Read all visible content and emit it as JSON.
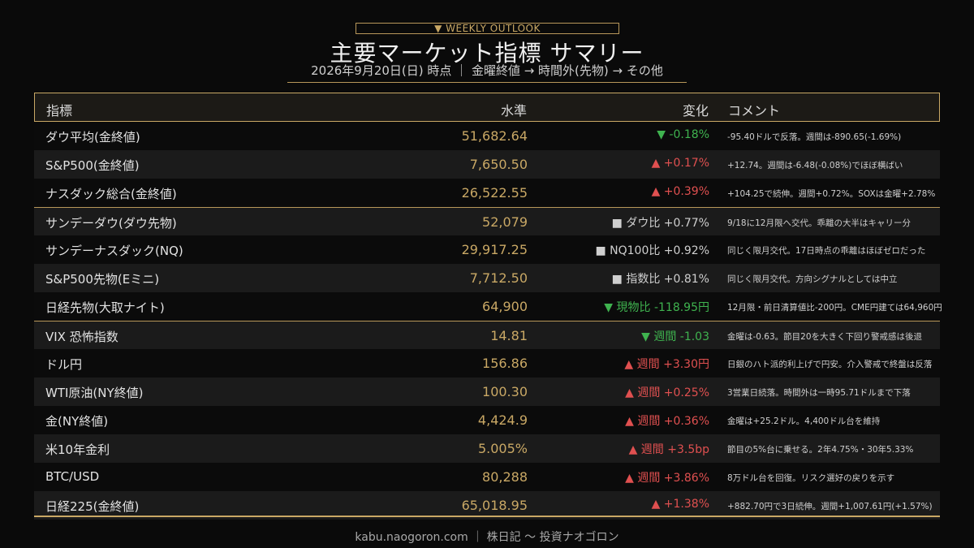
{
  "header": {
    "badge": "▼ WEEKLY OUTLOOK",
    "title": "主要マーケット指標 サマリー",
    "subtitle": "2026年9月20日(日) 時点 ｜ 金曜終値 → 時間外(先物) → その他"
  },
  "table": {
    "columns": {
      "name": "指標",
      "level": "水準",
      "change": "変化",
      "comment": "コメント"
    },
    "rows": [
      {
        "name": "ダウ平均(金終値)",
        "level": "51,682.64",
        "change": "▼ -0.18%",
        "dir": "down",
        "comment": "-95.40ドルで反落。週間は-890.65(-1.69%)"
      },
      {
        "name": "S&P500(金終値)",
        "level": "7,650.50",
        "change": "▲ +0.17%",
        "dir": "up",
        "comment": "+12.74。週間は-6.48(-0.08%)でほぼ横ばい"
      },
      {
        "name": "ナスダック総合(金終値)",
        "level": "26,522.55",
        "change": "▲ +0.39%",
        "dir": "up",
        "comment": "+104.25で続伸。週間+0.72%。SOXは金曜+2.78%"
      },
      {
        "name": "サンデーダウ(ダウ先物)",
        "level": "52,079",
        "change": "■ ダウ比 +0.77%",
        "dir": "neutral",
        "comment": "9/18に12月限へ交代。乖離の大半はキャリー分"
      },
      {
        "name": "サンデーナスダック(NQ)",
        "level": "29,917.25",
        "change": "■ NQ100比 +0.92%",
        "dir": "neutral",
        "comment": "同じく限月交代。17日時点の乖離はほぼゼロだった"
      },
      {
        "name": "S&P500先物(Eミニ)",
        "level": "7,712.50",
        "change": "■ 指数比 +0.81%",
        "dir": "neutral",
        "comment": "同じく限月交代。方向シグナルとしては中立"
      },
      {
        "name": "日経先物(大取ナイト)",
        "level": "64,900",
        "change": "▼ 現物比 -118.95円",
        "dir": "down",
        "comment": "12月限・前日清算値比-200円。CME円建ては64,960円"
      },
      {
        "name": "VIX 恐怖指数",
        "level": "14.81",
        "change": "▼ 週間 -1.03",
        "dir": "down",
        "comment": "金曜は-0.63。節目20を大きく下回り警戒感は後退"
      },
      {
        "name": "ドル円",
        "level": "156.86",
        "change": "▲ 週間 +3.30円",
        "dir": "up",
        "comment": "日銀のハト派的利上げで円安。介入警戒で終盤は反落"
      },
      {
        "name": "WTI原油(NY終値)",
        "level": "100.30",
        "change": "▲ 週間 +0.25%",
        "dir": "up",
        "comment": "3営業日続落。時間外は一時95.71ドルまで下落"
      },
      {
        "name": "金(NY終値)",
        "level": "4,424.9",
        "change": "▲ 週間 +0.36%",
        "dir": "up",
        "comment": "金曜は+25.2ドル。4,400ドル台を維持"
      },
      {
        "name": "米10年金利",
        "level": "5.005%",
        "change": "▲ 週間 +3.5bp",
        "dir": "up",
        "comment": "節目の5%台に乗せる。2年4.75%・30年5.33%"
      },
      {
        "name": "BTC/USD",
        "level": "80,288",
        "change": "▲ 週間 +3.86%",
        "dir": "up",
        "comment": "8万ドル台を回復。リスク選好の戻りを示す"
      },
      {
        "name": "日経225(金終値)",
        "level": "65,018.95",
        "change": "▲ +1.38%",
        "dir": "up",
        "comment": "+882.70円で3日続伸。週間+1,007.61円(+1.57%)"
      }
    ]
  },
  "footer": {
    "text": "kabu.naogoron.com ｜ 株日記 〜 投資ナオゴロン"
  },
  "colors": {
    "gold": "#c9a865",
    "up": "#e05050",
    "down": "#3fb34f",
    "background": "#0a0a0a"
  }
}
